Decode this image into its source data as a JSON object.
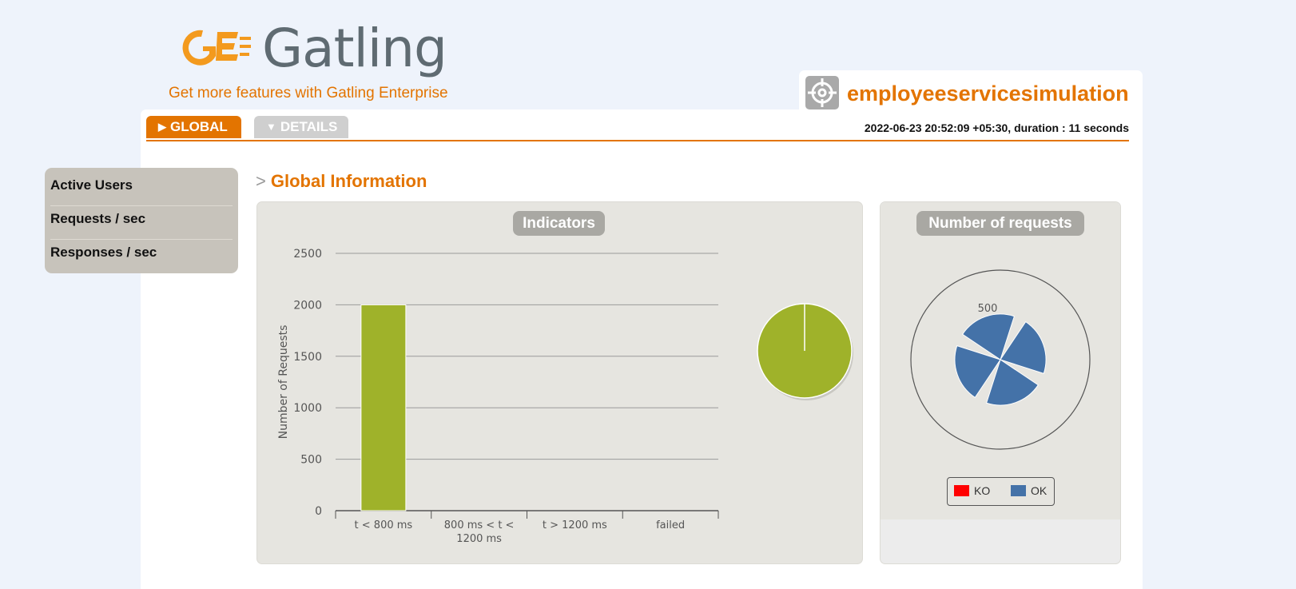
{
  "header": {
    "logo_text": "Gatling",
    "promo_link": "Get more features with Gatling Enterprise",
    "simulation_name": "employeeservicesimulation",
    "run_info": "2022-06-23 20:52:09 +05:30, duration : 11 seconds"
  },
  "tabs": [
    {
      "label": "GLOBAL",
      "active": true
    },
    {
      "label": "DETAILS",
      "active": false
    }
  ],
  "sidebar": {
    "items": [
      {
        "label": "Active Users"
      },
      {
        "label": "Requests / sec"
      },
      {
        "label": "Responses / sec"
      }
    ]
  },
  "section": {
    "chevron": ">",
    "title": "Global Information"
  },
  "colors": {
    "accent": "#e37400",
    "bar_green": "#9fb22a",
    "ok_blue": "#4472a8",
    "ko_red": "#ff0000"
  },
  "chart_data": [
    {
      "type": "bar",
      "title": "Indicators",
      "ylabel": "Number of Requests",
      "categories": [
        "t < 800 ms",
        "800 ms < t < 1200 ms",
        "t > 1200 ms",
        "failed"
      ],
      "values": [
        2000,
        0,
        0,
        0
      ],
      "ylim": [
        0,
        2500
      ],
      "yticks": [
        "0",
        "500",
        "1000",
        "1500",
        "2000",
        "2500"
      ],
      "pie": {
        "values": [
          2000,
          0,
          0,
          0
        ]
      }
    },
    {
      "type": "pie",
      "title": "Number of requests",
      "slices": [
        {
          "name": "OK",
          "value": 500
        },
        {
          "name": "OK",
          "value": 500
        },
        {
          "name": "OK",
          "value": 500
        },
        {
          "name": "OK",
          "value": 500
        }
      ],
      "data_label": "500",
      "legend": [
        {
          "name": "KO",
          "color": "#ff0000"
        },
        {
          "name": "OK",
          "color": "#4472a8"
        }
      ]
    }
  ]
}
